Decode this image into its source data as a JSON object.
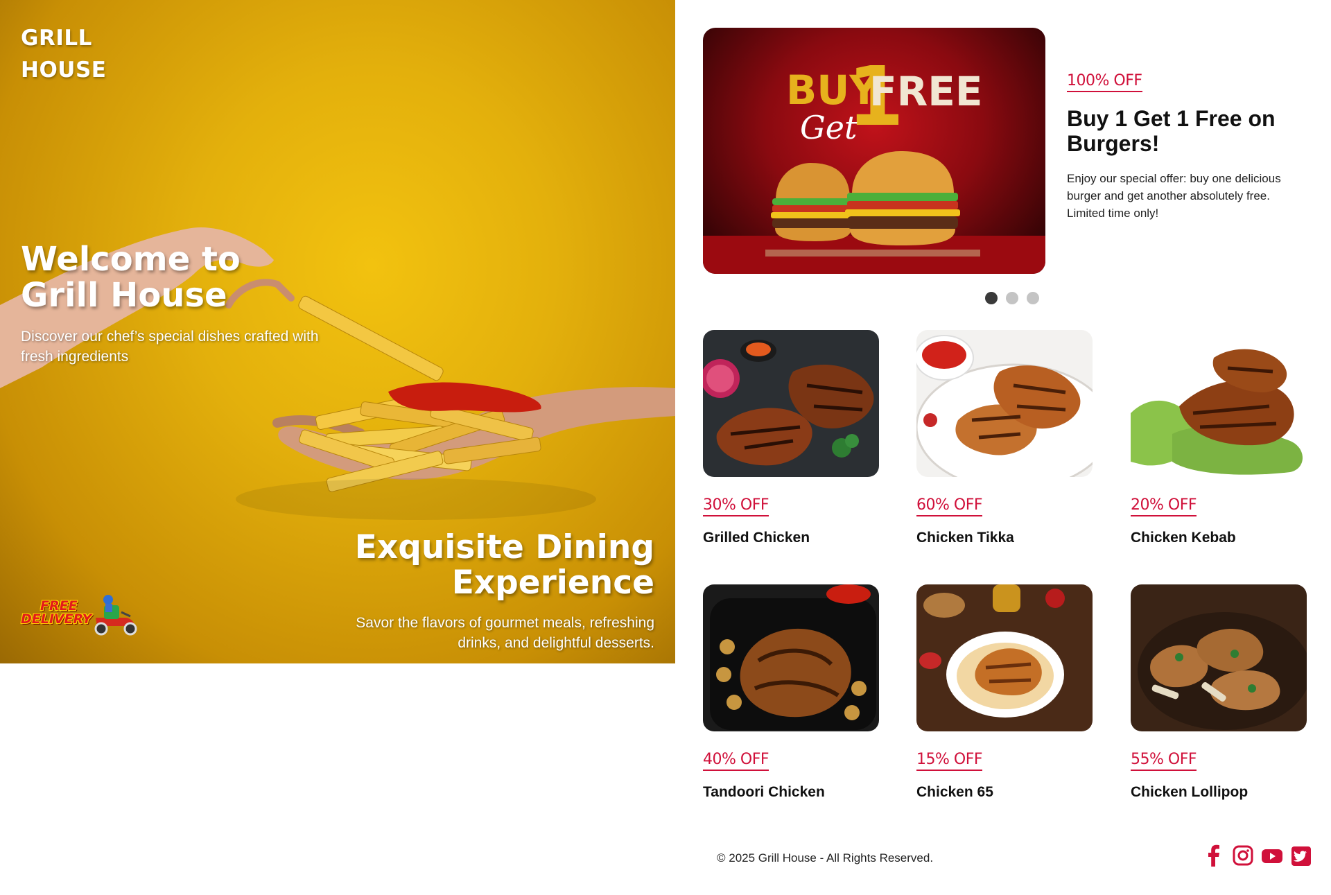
{
  "brand": {
    "line1": "GRILL",
    "line2": "HOUSE"
  },
  "hero": {
    "title": "Welcome to Grill House",
    "subtitle": "Discover our chef’s special dishes crafted with fresh ingredients",
    "title2": "Exquisite Dining Experience",
    "subtitle2": "Savor the flavors of gourmet meals, refreshing drinks, and delightful desserts.",
    "delivery_badge": {
      "line1": "FREE",
      "line2": "DELIVERY"
    }
  },
  "promo": {
    "badge": "100% OFF",
    "title": "Buy 1 Get 1 Free on Burgers!",
    "description": "Enjoy our special offer: buy one delicious burger and get another absolutely free. Limited time only!",
    "image_text": {
      "buy": "BUY",
      "one": "1",
      "get": "Get",
      "free": "FREE"
    },
    "slides": {
      "total": 3,
      "active": 1
    }
  },
  "menu": {
    "items": [
      {
        "badge": "30% OFF",
        "name": "Grilled Chicken"
      },
      {
        "badge": "60% OFF",
        "name": "Chicken Tikka"
      },
      {
        "badge": "20% OFF",
        "name": "Chicken Kebab"
      },
      {
        "badge": "40% OFF",
        "name": "Tandoori Chicken"
      },
      {
        "badge": "15% OFF",
        "name": "Chicken 65"
      },
      {
        "badge": "55% OFF",
        "name": "Chicken Lollipop"
      }
    ]
  },
  "footer": {
    "copyright": "© 2025 Grill House - All Rights Reserved.",
    "socials": [
      "facebook-icon",
      "instagram-icon",
      "youtube-icon",
      "twitter-icon"
    ]
  },
  "colors": {
    "accent": "#d0103a",
    "hero_bg": "#e3b00c",
    "promo_bg": "#8a0a10",
    "dot_active": "#3a3a3a",
    "dot_inactive": "#c4c4c4"
  }
}
